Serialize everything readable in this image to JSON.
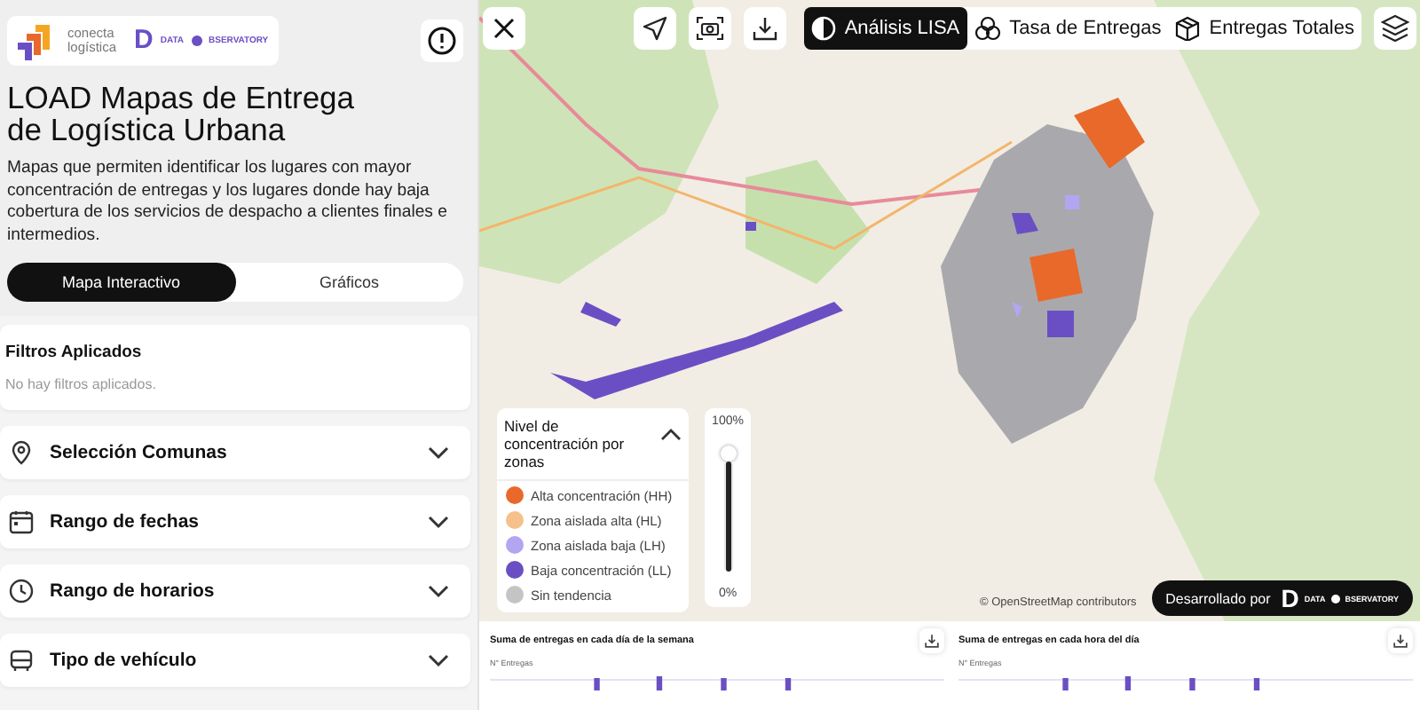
{
  "sidebar": {
    "logo": {
      "brand_line_1": "conecta",
      "brand_line_2": "logística",
      "partner_mark": "D",
      "partner_text_1": "DATA",
      "partner_text_2": "BSERVATORY"
    },
    "title": "LOAD Mapas de Entrega de Logística Urbana",
    "description": "Mapas que permiten identificar los lugares con mayor concentración de entregas y los lugares donde hay baja cobertura de los servicios de despacho a clientes finales e intermedios.",
    "view_tabs": [
      {
        "label": "Mapa Interactivo",
        "selected": true
      },
      {
        "label": "Gráficos",
        "selected": false
      }
    ],
    "applied_filters": {
      "title": "Filtros Aplicados",
      "empty_text": "No hay filtros aplicados."
    },
    "filters": [
      {
        "label": "Selección Comunas",
        "expanded": false
      },
      {
        "label": "Rango de fechas",
        "expanded": false
      },
      {
        "label": "Rango de horarios",
        "expanded": false
      },
      {
        "label": "Tipo de vehículo",
        "expanded": false
      }
    ]
  },
  "map": {
    "layer_tabs": [
      {
        "label": "Análisis LISA",
        "selected": true
      },
      {
        "label": "Tasa de Entregas",
        "selected": false
      },
      {
        "label": "Entregas Totales",
        "selected": false
      }
    ],
    "legend": {
      "title": "Nivel de concentración por zonas",
      "expanded": true,
      "items": [
        {
          "label": "Alta concentración (HH)",
          "color": "#e8692a"
        },
        {
          "label": "Zona aislada alta (HL)",
          "color": "#f5c08a"
        },
        {
          "label": "Zona aislada baja (LH)",
          "color": "#b4a5f2"
        },
        {
          "label": "Baja concentración (LL)",
          "color": "#6a4fc4"
        },
        {
          "label": "Sin tendencia",
          "color": "#c4c4c4"
        }
      ]
    },
    "opacity": {
      "max_label": "100%",
      "min_label": "0%",
      "level": 1
    },
    "attribution": "© OpenStreetMap contributors",
    "credit": {
      "label": "Desarrollado por",
      "mark": "D",
      "text_1": "DATA",
      "text_2": "BSERVATORY"
    }
  },
  "charts": [
    {
      "title": "Suma de entregas en cada día de la semana",
      "ylabel": "N° Entregas"
    },
    {
      "title": "Suma de entregas en cada hora del día",
      "ylabel": "N° Entregas"
    }
  ]
}
